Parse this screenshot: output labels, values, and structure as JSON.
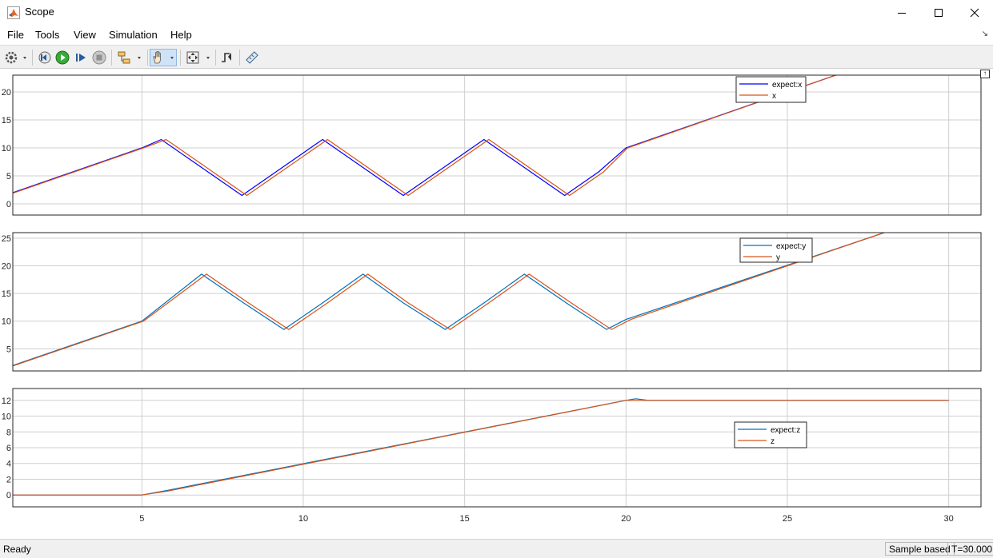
{
  "window": {
    "title": "Scope"
  },
  "menu": [
    "File",
    "Tools",
    "View",
    "Simulation",
    "Help"
  ],
  "toolbar": [
    {
      "name": "configuration-gear"
    },
    {
      "name": "step-back"
    },
    {
      "name": "run"
    },
    {
      "name": "step-forward"
    },
    {
      "name": "stop"
    },
    {
      "name": "highlight-block"
    },
    {
      "name": "pan"
    },
    {
      "name": "scale-axes"
    },
    {
      "name": "triggers"
    },
    {
      "name": "cursor-measurements"
    }
  ],
  "colors": {
    "blue": "#0000ff",
    "orange": "#d95319",
    "teal": "#0072bd",
    "grid": "#cfcfcf"
  },
  "status": {
    "ready": "Ready",
    "mode": "Sample based",
    "time": "T=30.000"
  },
  "chart_data": [
    {
      "type": "line",
      "x_range": [
        1,
        31
      ],
      "ylim": [
        -2,
        23
      ],
      "yticks": [
        0,
        5,
        10,
        15,
        20
      ],
      "xticks": [
        5,
        10,
        15,
        20,
        25,
        30
      ],
      "legend": "top-right",
      "series": [
        {
          "name": "expect:x",
          "color": "#0000ff",
          "x": [
            1,
            5,
            5.6,
            7.05,
            8.1,
            9.15,
            10.6,
            12.05,
            13.1,
            14.15,
            15.6,
            17.05,
            18.1,
            19.15,
            20,
            26.5
          ],
          "y": [
            2,
            10,
            11.5,
            5.7,
            1.5,
            5.7,
            11.5,
            5.7,
            1.5,
            5.7,
            11.5,
            5.7,
            1.5,
            5.7,
            10,
            23
          ]
        },
        {
          "name": "x",
          "color": "#d95319",
          "x": [
            1,
            5.05,
            5.75,
            7.2,
            8.25,
            9.3,
            10.75,
            12.2,
            13.25,
            14.3,
            15.75,
            17.2,
            18.25,
            19.3,
            20.05,
            26.5
          ],
          "y": [
            1.9,
            10,
            11.5,
            5.7,
            1.5,
            5.7,
            11.5,
            5.7,
            1.5,
            5.7,
            11.5,
            5.7,
            1.5,
            5.7,
            10,
            23
          ]
        }
      ]
    },
    {
      "type": "line",
      "x_range": [
        1,
        31
      ],
      "ylim": [
        1,
        26
      ],
      "yticks": [
        5,
        10,
        15,
        20,
        25
      ],
      "xticks": [
        5,
        10,
        15,
        20,
        25,
        30
      ],
      "legend": "top-right",
      "series": [
        {
          "name": "expect:y",
          "color": "#0072bd",
          "x": [
            1,
            5,
            6.85,
            8.15,
            9.4,
            10.6,
            11.85,
            13.1,
            14.4,
            15.6,
            16.85,
            18.15,
            19.4,
            20,
            28
          ],
          "y": [
            2,
            10,
            18.5,
            13.3,
            8.5,
            13.3,
            18.5,
            13.3,
            8.5,
            13.3,
            18.5,
            13.3,
            8.5,
            10.3,
            26
          ]
        },
        {
          "name": "y",
          "color": "#d95319",
          "x": [
            1,
            5.05,
            7,
            8.3,
            9.55,
            10.75,
            12,
            13.25,
            14.55,
            15.75,
            17,
            18.3,
            19.55,
            20.15,
            28
          ],
          "y": [
            1.9,
            10,
            18.5,
            13.3,
            8.5,
            13.3,
            18.5,
            13.3,
            8.5,
            13.3,
            18.5,
            13.3,
            8.5,
            10.3,
            26
          ]
        }
      ]
    },
    {
      "type": "line",
      "x_range": [
        1,
        31
      ],
      "ylim": [
        -1.5,
        13.5
      ],
      "yticks": [
        0,
        2,
        4,
        6,
        8,
        10,
        12
      ],
      "xticks": [
        5,
        10,
        15,
        20,
        25,
        30
      ],
      "xticklabels": [
        "5",
        "10",
        "15",
        "20",
        "25",
        "30"
      ],
      "legend": "right",
      "series": [
        {
          "name": "expect:z",
          "color": "#0072bd",
          "x": [
            1,
            5,
            5.8,
            20,
            20.3,
            20.7,
            30
          ],
          "y": [
            0,
            0,
            0.6,
            12,
            12.2,
            12,
            12
          ]
        },
        {
          "name": "z",
          "color": "#d95319",
          "x": [
            1,
            5,
            5.8,
            20,
            20.5,
            30
          ],
          "y": [
            0,
            0,
            0.5,
            12,
            12,
            12
          ]
        }
      ]
    }
  ]
}
